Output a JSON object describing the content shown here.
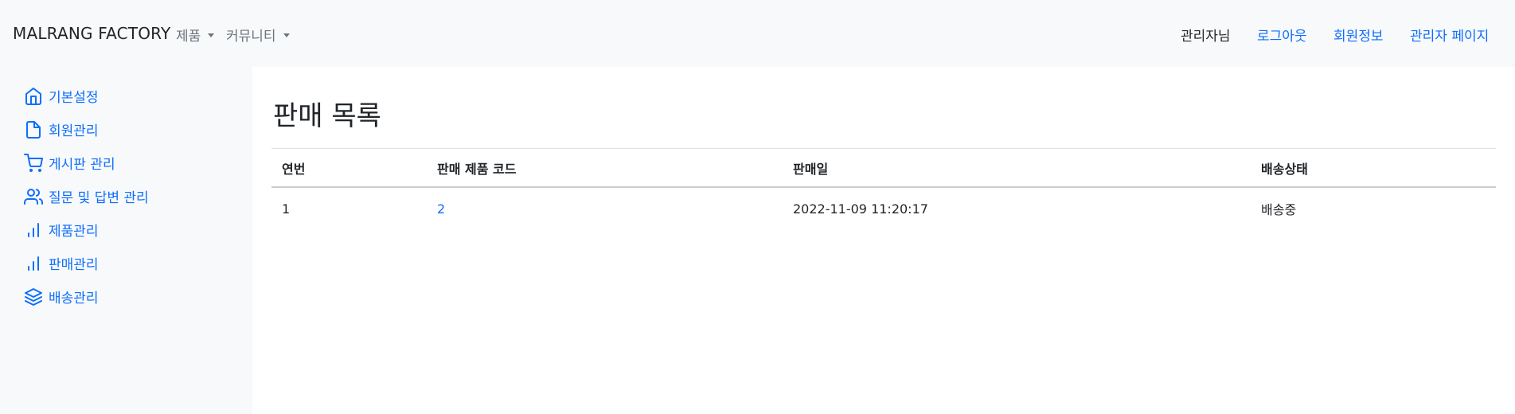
{
  "navbar": {
    "brand": "MALRANG FACTORY",
    "dropdowns": [
      {
        "label": "제품"
      },
      {
        "label": "커뮤니티"
      }
    ],
    "user_greeting": "관리자님",
    "links": [
      {
        "label": "로그아웃"
      },
      {
        "label": "회원정보"
      },
      {
        "label": "관리자 페이지"
      }
    ]
  },
  "sidebar": {
    "items": [
      {
        "label": "기본설정",
        "icon": "home-icon"
      },
      {
        "label": "회원관리",
        "icon": "file-icon"
      },
      {
        "label": "게시판 관리",
        "icon": "shopping-cart-icon"
      },
      {
        "label": "질문 및 답변 관리",
        "icon": "users-icon"
      },
      {
        "label": "제품관리",
        "icon": "bar-chart-icon"
      },
      {
        "label": "판매관리",
        "icon": "bar-chart-icon"
      },
      {
        "label": "배송관리",
        "icon": "layers-icon"
      }
    ]
  },
  "main": {
    "title": "판매 목록",
    "table": {
      "headers": [
        "연번",
        "판매 제품 코드",
        "판매일",
        "배송상태"
      ],
      "rows": [
        {
          "index": "1",
          "product_code": "2",
          "sale_date": "2022-11-09 11:20:17",
          "status": "배송중"
        }
      ]
    }
  },
  "colors": {
    "link": "#0d6efd",
    "navbar_bg": "#f8f9fa",
    "muted": "#6c757d"
  }
}
